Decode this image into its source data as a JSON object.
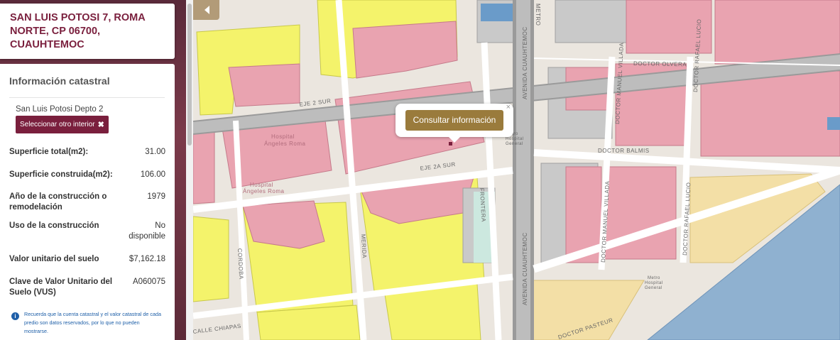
{
  "address": "SAN LUIS POTOSI 7, ROMA NORTE, CP 06700, CUAUHTEMOC",
  "panel": {
    "title": "Información catastral",
    "interior": "San Luis Potosi Depto 2",
    "select_other_label": "Seleccionar otro interior",
    "rows": [
      {
        "label": "Superficie total(m2):",
        "value": "31.00"
      },
      {
        "label": "Superficie construida(m2):",
        "value": "106.00"
      },
      {
        "label": "Año de la construcción o remodelación",
        "value": "1979"
      },
      {
        "label": "Uso de la construcción",
        "value": "No disponible"
      },
      {
        "label": "Valor unitario del suelo",
        "value": "$7,162.18"
      },
      {
        "label": "Clave de Valor Unitario del Suelo (VUS)",
        "value": "A060075"
      }
    ],
    "note": "Recuerda que la cuenta catastral y el valor catastral de cada predio son datos reservados, por lo que no pueden mostrarse."
  },
  "map": {
    "popup_button": "Consultar información",
    "popup_close": "×",
    "streets": {
      "eje2sur": "EJE 2 SUR",
      "eje2asur": "EJE 2A SUR",
      "cuauhtemoc": "AVENIDA CUAUHTEMOC",
      "cuauhtemoc2": "AVENIDA CUAUHTEMOC",
      "olvera": "DOCTOR OLVERA",
      "balmis": "DOCTOR BALMIS",
      "villada1": "DOCTOR MANUEL VILLADA",
      "villada2": "DOCTOR MANUEL VILLADA",
      "lucio1": "DOCTOR RAFAEL LUCIO",
      "lucio2": "DOCTOR RAFAEL LUCIO",
      "pasteur": "DOCTOR PASTEUR",
      "frontera": "FRONTERA",
      "merida": "MERIDA",
      "cordoba": "CORDOBA",
      "chiapas": "CALLE CHIAPAS",
      "metro": "METRO",
      "hospital1": "Hospital",
      "hospital1b": "Ángeles Roma",
      "hospital2": "Hospital",
      "hospital2b": "Ángeles Roma",
      "metro_hosp1": "Metro",
      "metro_hosp1b": "Hospital",
      "metro_hosp1c": "General",
      "metro_hosp2": "Metro",
      "metro_hosp2b": "Hospital",
      "metro_hosp2c": "General"
    },
    "colors": {
      "pink": "#e9a3b0",
      "yellow": "#f4f36b",
      "gray": "#c9c9c9",
      "blue": "#8fb1d0",
      "tan": "#f3dfa6"
    }
  }
}
